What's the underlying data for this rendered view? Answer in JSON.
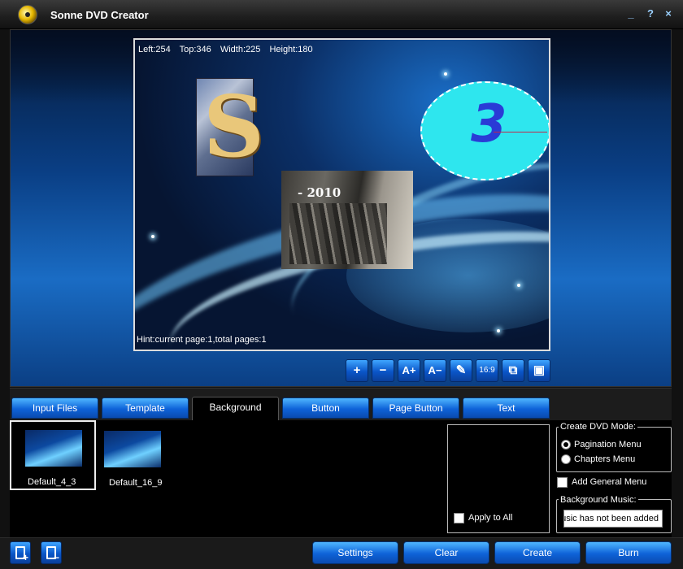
{
  "window": {
    "title": "Sonne DVD Creator",
    "controls": {
      "minimize": "_",
      "help": "?",
      "close": "×"
    }
  },
  "canvas": {
    "info": {
      "left": "Left:254",
      "top": "Top:346",
      "width": "Width:225",
      "height": "Height:180"
    },
    "hint": "Hint:current page:1,total pages:1",
    "clock_number": "3",
    "photo_caption": "- 2010"
  },
  "zoom_toolbar": {
    "zoom_in": "+",
    "zoom_out": "−",
    "font_up": "A+",
    "font_down": "A−",
    "edit": "✎",
    "aspect": "16:9",
    "add_frame": "⧉",
    "remove_frame": "▣"
  },
  "tabs": [
    {
      "label": "Input Files"
    },
    {
      "label": "Template"
    },
    {
      "label": "Background",
      "active": true
    },
    {
      "label": "Button"
    },
    {
      "label": "Page Button"
    },
    {
      "label": "Text"
    }
  ],
  "backgrounds": [
    {
      "label": "Default_4_3",
      "selected": true
    },
    {
      "label": "Default_16_9",
      "selected": false
    }
  ],
  "options": {
    "apply_to_all": "Apply to All",
    "create_mode_label": "Create DVD Mode:",
    "pagination_menu": "Pagination Menu",
    "chapters_menu": "Chapters Menu",
    "selected_mode": "Pagination Menu",
    "add_general_menu": "Add General Menu",
    "background_music_label": "Background Music:",
    "background_music_value": "Music has not been added"
  },
  "bottom": {
    "add_icon": "+",
    "remove_icon": "−",
    "settings": "Settings",
    "clear": "Clear",
    "create": "Create",
    "burn": "Burn"
  }
}
